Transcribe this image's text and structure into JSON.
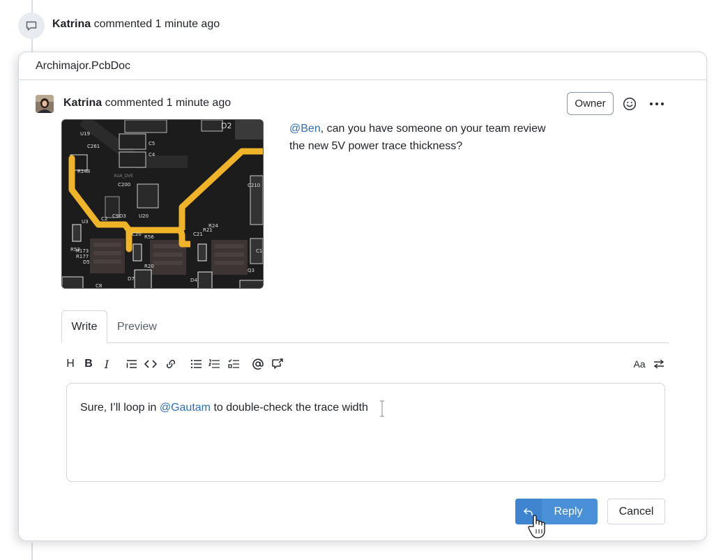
{
  "timeline_event": {
    "author": "Katrina",
    "action": "commented 1 minute ago"
  },
  "card": {
    "file_name": "Archimajor.PcbDoc"
  },
  "comment": {
    "author": "Katrina",
    "meta": "commented 1 minute ago",
    "owner_label": "Owner",
    "mention": "@Ben",
    "body_rest_line1": ", can you have someone on your team review",
    "body_line2": "the new 5V power trace thickness?",
    "image_labels": [
      "U19",
      "C261",
      "R148",
      "D2",
      "C5",
      "C4",
      "XUA_DVE",
      "C200",
      "C210",
      "U20",
      "U3",
      "C2",
      "C9",
      "D3",
      "C20",
      "R56",
      "C21",
      "R21",
      "R24",
      "C19",
      "R53",
      "R173",
      "R177",
      "D5",
      "D7",
      "R20",
      "D4",
      "Q3",
      "C8"
    ]
  },
  "editor": {
    "tabs": [
      "Write",
      "Preview"
    ],
    "active_tab": "Write",
    "toolbar": {
      "heading": "H",
      "bold": "B",
      "italic": "I",
      "font_size": "Aa"
    },
    "text_before": "Sure, I’ll loop in ",
    "mention": "@Gautam",
    "text_after": " to double-check the trace width"
  },
  "actions": {
    "reply_label": "Reply",
    "cancel_label": "Cancel"
  },
  "colors": {
    "accent_blue": "#4a90d9",
    "mention_blue": "#2f6fb7",
    "trace_yellow": "#f0b429",
    "pcb_background": "#1a1a1a"
  },
  "icons": [
    "comment-icon",
    "smiley-icon",
    "more-icon",
    "reply-arrow-icon",
    "hand-cursor-icon"
  ]
}
